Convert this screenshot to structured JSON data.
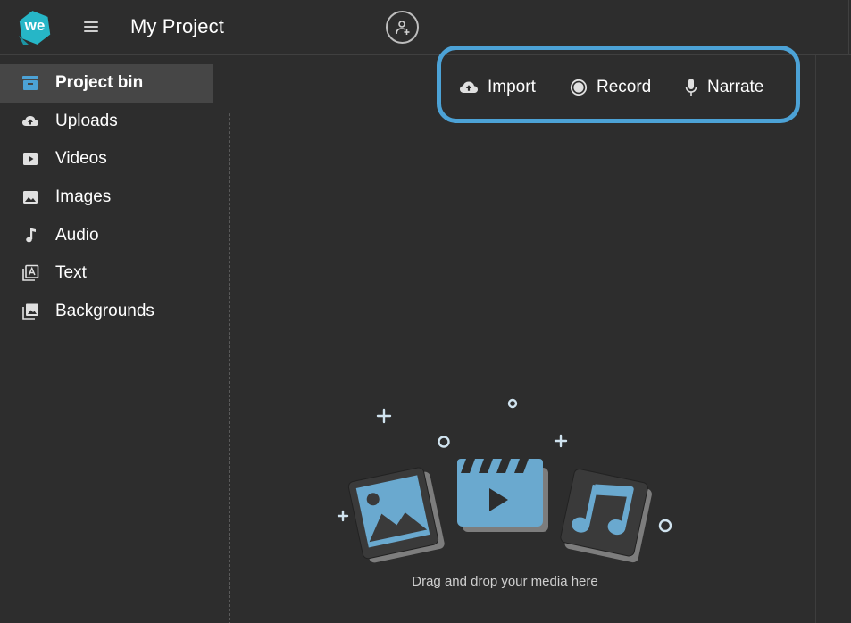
{
  "header": {
    "project_title": "My Project",
    "logo_text": "we"
  },
  "sidebar": {
    "items": [
      {
        "label": "Project bin",
        "icon": "archive-icon",
        "active": true
      },
      {
        "label": "Uploads",
        "icon": "cloud-upload-icon",
        "active": false
      },
      {
        "label": "Videos",
        "icon": "play-box-icon",
        "active": false
      },
      {
        "label": "Images",
        "icon": "image-icon",
        "active": false
      },
      {
        "label": "Audio",
        "icon": "music-note-icon",
        "active": false
      },
      {
        "label": "Text",
        "icon": "text-box-icon",
        "active": false
      },
      {
        "label": "Backgrounds",
        "icon": "backgrounds-icon",
        "active": false
      }
    ]
  },
  "toolbar": {
    "import_label": "Import",
    "record_label": "Record",
    "narrate_label": "Narrate"
  },
  "dropzone": {
    "hint": "Drag and drop your media here"
  },
  "colors": {
    "background": "#2d2d2d",
    "active_item": "#464646",
    "accent_blue": "#4ca2d6",
    "logo_teal": "#26b6c7",
    "illustration_blue": "#6aa9cf"
  }
}
